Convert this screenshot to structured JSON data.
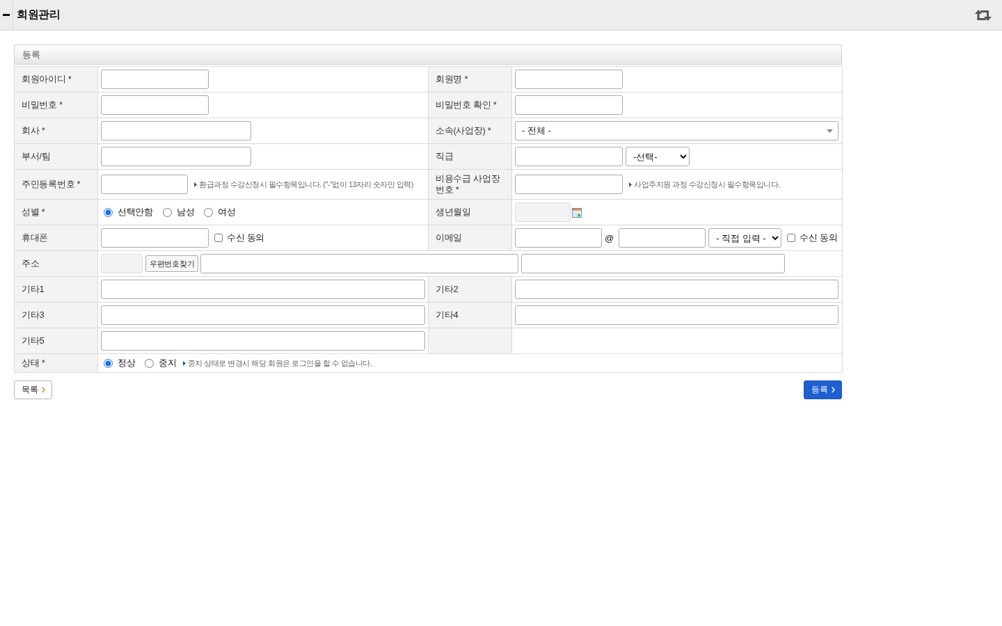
{
  "header": {
    "title": "회원관리"
  },
  "form": {
    "caption": "등록",
    "rows": [
      {
        "kind": "pair",
        "fields": [
          {
            "label": "회원아이디 *",
            "controls": [
              {
                "kind": "input",
                "disabled": false
              }
            ]
          },
          {
            "label": "회원명 *",
            "controls": [
              {
                "kind": "input",
                "disabled": false
              }
            ]
          }
        ]
      },
      {
        "kind": "pair",
        "fields": [
          {
            "label": "비밀번호 *",
            "controls": [
              {
                "kind": "input",
                "disabled": false
              }
            ]
          },
          {
            "label": "비밀번호 확인 *",
            "controls": [
              {
                "kind": "input",
                "disabled": false
              }
            ]
          }
        ]
      },
      {
        "kind": "pair",
        "fields": [
          {
            "label": "회사 *",
            "controls": [
              {
                "kind": "input",
                "disabled": false
              }
            ]
          },
          {
            "label": "소속(사업장) *",
            "controls": [
              {
                "kind": "dropdown",
                "value": "- 전체 -"
              }
            ]
          }
        ]
      },
      {
        "kind": "pair",
        "fields": [
          {
            "label": "부서/팀",
            "controls": [
              {
                "kind": "input",
                "disabled": false
              }
            ]
          },
          {
            "label": "직급",
            "controls": [
              {
                "kind": "input",
                "disabled": false
              },
              {
                "kind": "select",
                "value": "-선택-"
              }
            ]
          }
        ]
      },
      {
        "kind": "pair",
        "fields": [
          {
            "label": "주민등록번호 *",
            "controls": [
              {
                "kind": "input",
                "disabled": false
              },
              {
                "kind": "note",
                "text": "환급과정 수강신청시 필수항목입니다. (\"-\"없이 13자리 숫자만 입력)"
              }
            ]
          },
          {
            "label": "비용수급 사업장 번호 *",
            "controls": [
              {
                "kind": "input",
                "disabled": false
              },
              {
                "kind": "note",
                "text": "사업주지원 과정 수강신청시 필수항목입니다."
              }
            ]
          }
        ]
      },
      {
        "kind": "pair",
        "fields": [
          {
            "label": "성별 *",
            "controls": [
              {
                "kind": "radio-group",
                "options": [
                  {
                    "label": "선택안함",
                    "selected": true
                  },
                  {
                    "label": "남성",
                    "selected": false
                  },
                  {
                    "label": "여성",
                    "selected": false
                  }
                ]
              }
            ]
          },
          {
            "label": "생년월일",
            "controls": [
              {
                "kind": "date",
                "disabled": true
              }
            ]
          }
        ]
      },
      {
        "kind": "pair",
        "fields": [
          {
            "label": "휴대폰",
            "controls": [
              {
                "kind": "input",
                "disabled": false
              },
              {
                "kind": "checkbox",
                "label": "수신 동의",
                "checked": false
              }
            ]
          },
          {
            "label": "이메일",
            "controls": [
              {
                "kind": "input",
                "disabled": false
              },
              {
                "kind": "text",
                "text": "@"
              },
              {
                "kind": "input",
                "disabled": false
              },
              {
                "kind": "select",
                "value": "- 직접 입력 -"
              },
              {
                "kind": "checkbox",
                "label": "수신 동의",
                "checked": false
              }
            ]
          }
        ]
      },
      {
        "kind": "wide",
        "fields": [
          {
            "label": "주소",
            "controls": [
              {
                "kind": "input",
                "disabled": true
              },
              {
                "kind": "button",
                "label": "우편번호찾기"
              },
              {
                "kind": "input",
                "disabled": false
              },
              {
                "kind": "input",
                "disabled": false
              }
            ]
          }
        ]
      },
      {
        "kind": "pair",
        "fields": [
          {
            "label": "기타1",
            "controls": [
              {
                "kind": "input",
                "disabled": false
              }
            ]
          },
          {
            "label": "기타2",
            "controls": [
              {
                "kind": "input",
                "disabled": false
              }
            ]
          }
        ]
      },
      {
        "kind": "pair",
        "fields": [
          {
            "label": "기타3",
            "controls": [
              {
                "kind": "input",
                "disabled": false
              }
            ]
          },
          {
            "label": "기타4",
            "controls": [
              {
                "kind": "input",
                "disabled": false
              }
            ]
          }
        ]
      },
      {
        "kind": "pair",
        "fields": [
          {
            "label": "기타5",
            "controls": [
              {
                "kind": "input",
                "disabled": false
              }
            ]
          }
        ]
      },
      {
        "kind": "wide",
        "fields": [
          {
            "label": "상태 *",
            "controls": [
              {
                "kind": "radio-group",
                "options": [
                  {
                    "label": "정상",
                    "selected": true
                  },
                  {
                    "label": "중지",
                    "selected": false
                  }
                ]
              },
              {
                "kind": "note",
                "text": "중지 상태로 변경시 해당 회원은 로그인을 할 수 없습니다."
              }
            ]
          }
        ]
      }
    ]
  },
  "actions": [
    {
      "kind": "secondary",
      "label": "목록"
    },
    {
      "kind": "primary",
      "label": "등록"
    }
  ]
}
